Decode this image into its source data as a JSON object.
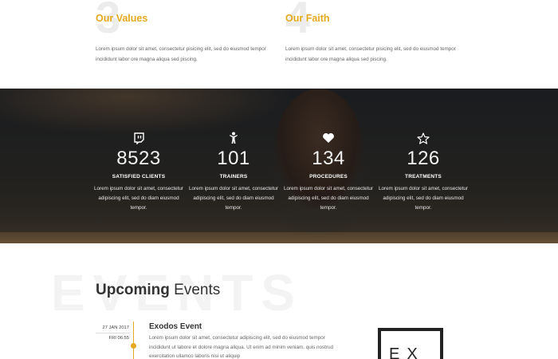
{
  "values": [
    {
      "number": "3",
      "title": "Our Values",
      "text": "Lorem ipsum dolor sit amet, consectetur pisicing elit, sed do eiusmod tempor incididunt labor ore magna aliqua sed piscing."
    },
    {
      "number": "4",
      "title": "Our Faith",
      "text": "Lorem ipsum dolor sit amet, consectetur pisicing elit, sed do eiusmod tempor incididunt labor ore magna aliqua sed piscing."
    }
  ],
  "stats": [
    {
      "icon": "twitch-icon",
      "number": "8523",
      "label": "SATISFIED CLIENTS",
      "text": "Lorem ipsum dolor sit amet, consectetur adipiscing elit, sed do diam eiusmod tempor."
    },
    {
      "icon": "trainer-figure-icon",
      "number": "101",
      "label": "TRAINERS",
      "text": "Lorem ipsum dolor sit amet, consectetur adipiscing elit, sed do diam eiusmod tempor."
    },
    {
      "icon": "heart-icon",
      "number": "134",
      "label": "PROCEDURES",
      "text": "Lorem ipsum dolor sit amet, consectetur adipiscing elit, sed do diam eiusmod tempor."
    },
    {
      "icon": "star-icon",
      "number": "126",
      "label": "TREATMENTS",
      "text": "Lorem ipsum dolor sit amet, consectetur adipiscing elit, sed do diam eiusmod tempor."
    }
  ],
  "events": {
    "background_word": "EVENTS",
    "heading_bold": "Upcoming",
    "heading_light": " Events",
    "item": {
      "date": "27 JAN 2017",
      "time": "FRI 06:55",
      "title": "Exodos Event",
      "text": "Lorem ipsum dolor sit amet, consectetur adipiscing elit, sed do eiusmod tempor incididunt ut labore et dolore magna aliqua. Ut enim ad minim veniam, quis nostrud exercitation ullamco laboris nisi ut aliquip"
    },
    "logo_text": "EX"
  },
  "colors": {
    "accent": "#e5a91f",
    "dark_band": "#1e1f21"
  }
}
